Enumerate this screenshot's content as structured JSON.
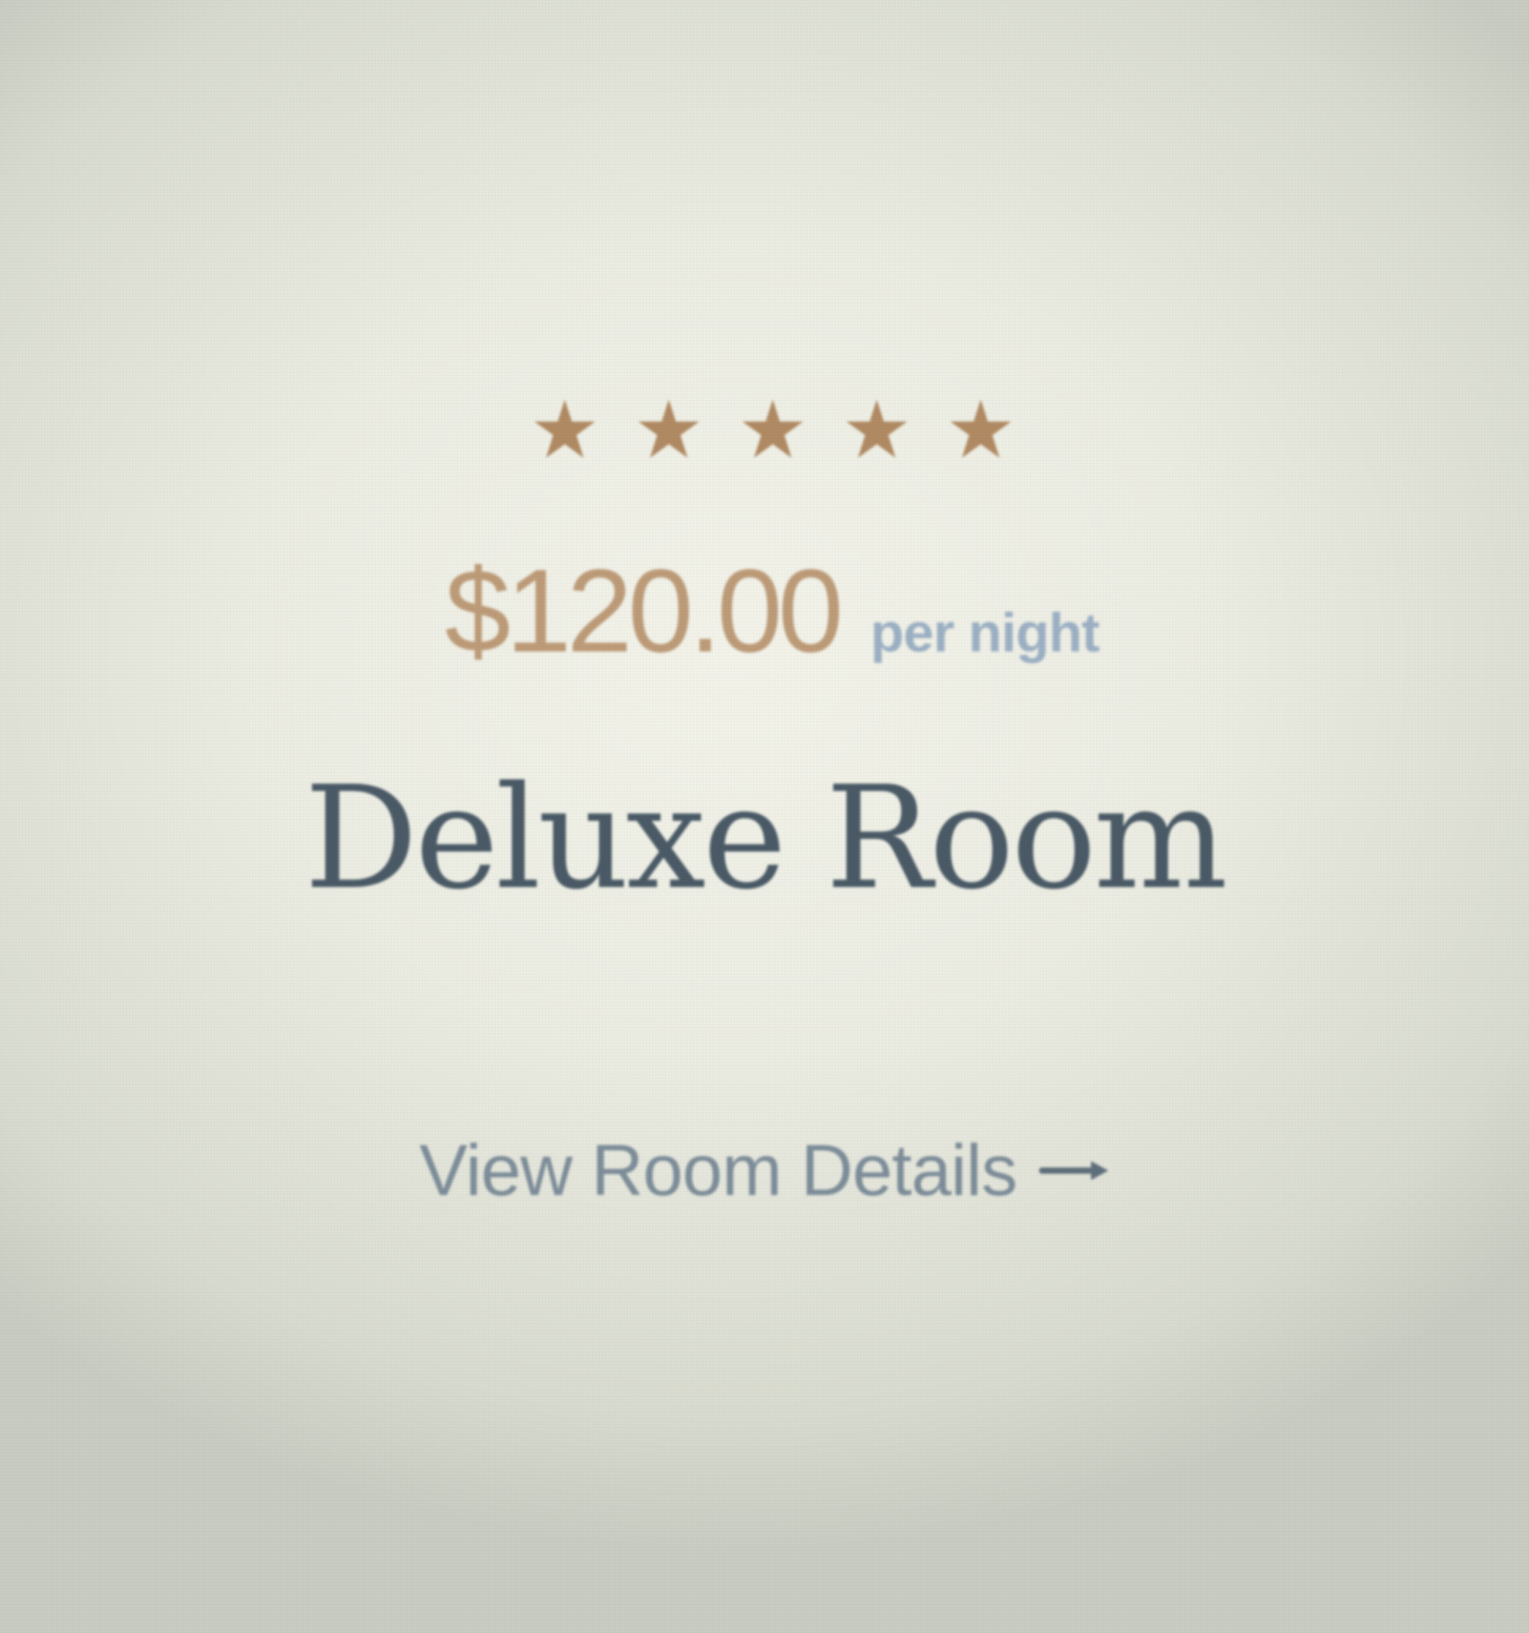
{
  "room_card": {
    "rating": 5,
    "rating_max": 5,
    "price": "$120.00",
    "price_unit": "per night",
    "title": "Deluxe Room",
    "details_link": "View Room Details",
    "icons": {
      "star": "star-icon",
      "arrow": "arrow-right-icon"
    },
    "colors": {
      "star": "#b08a63",
      "price": "#bd9b78",
      "price_unit": "#9cb0c4",
      "title": "#4a5a66",
      "link": "#7d8d99"
    }
  }
}
